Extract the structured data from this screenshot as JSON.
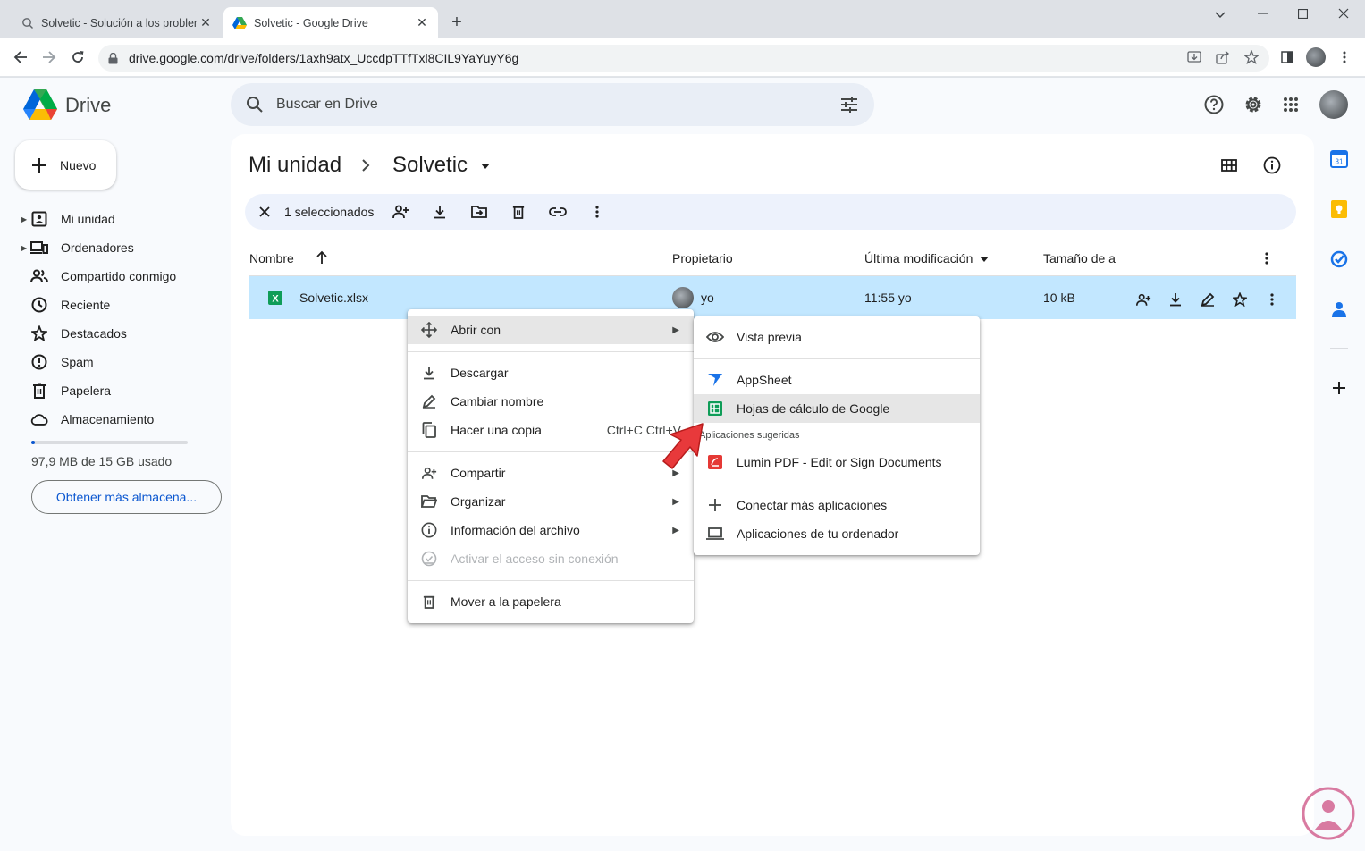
{
  "browser": {
    "tabs": [
      {
        "title": "Solvetic - Solución a los problem"
      },
      {
        "title": "Solvetic - Google Drive"
      }
    ],
    "url": "drive.google.com/drive/folders/1axh9atx_UccdpTTfTxl8CIL9YaYuyY6g"
  },
  "drive": {
    "logo_label": "Drive",
    "search_placeholder": "Buscar en Drive",
    "new_button": "Nuevo",
    "nav": [
      {
        "label": "Mi unidad"
      },
      {
        "label": "Ordenadores"
      },
      {
        "label": "Compartido conmigo"
      },
      {
        "label": "Reciente"
      },
      {
        "label": "Destacados"
      },
      {
        "label": "Spam"
      },
      {
        "label": "Papelera"
      },
      {
        "label": "Almacenamiento"
      }
    ],
    "storage": {
      "text": "97,9 MB de 15 GB usado",
      "fraction": 0.0065,
      "cta": "Obtener más almacena..."
    },
    "breadcrumb": {
      "root": "Mi unidad",
      "current": "Solvetic"
    },
    "selection_count": "1 seleccionados",
    "columns": {
      "name": "Nombre",
      "owner": "Propietario",
      "modified": "Última modificación",
      "size": "Tamaño de a"
    },
    "file": {
      "name": "Solvetic.xlsx",
      "owner": "yo",
      "modified": "11:55 yo",
      "size": "10 kB"
    }
  },
  "context_menu": {
    "items": [
      {
        "label": "Abrir con"
      },
      {
        "label": "Descargar"
      },
      {
        "label": "Cambiar nombre"
      },
      {
        "label": "Hacer una copia",
        "shortcut": "Ctrl+C Ctrl+V"
      },
      {
        "label": "Compartir"
      },
      {
        "label": "Organizar"
      },
      {
        "label": "Información del archivo"
      },
      {
        "label": "Activar el acceso sin conexión"
      },
      {
        "label": "Mover a la papelera"
      }
    ]
  },
  "open_with_menu": {
    "preview": "Vista previa",
    "apps": [
      {
        "label": "AppSheet"
      },
      {
        "label": "Hojas de cálculo de Google"
      }
    ],
    "suggested_header": "Aplicaciones sugeridas",
    "suggested": [
      {
        "label": "Lumin PDF - Edit or Sign Documents"
      }
    ],
    "connect": "Conectar más aplicaciones",
    "computer": "Aplicaciones de tu ordenador"
  },
  "colors": {
    "selection": "#c2e7ff",
    "accent": "#0b57d0",
    "sheets_green": "#0f9d58",
    "arrow_red": "#e8393b"
  }
}
